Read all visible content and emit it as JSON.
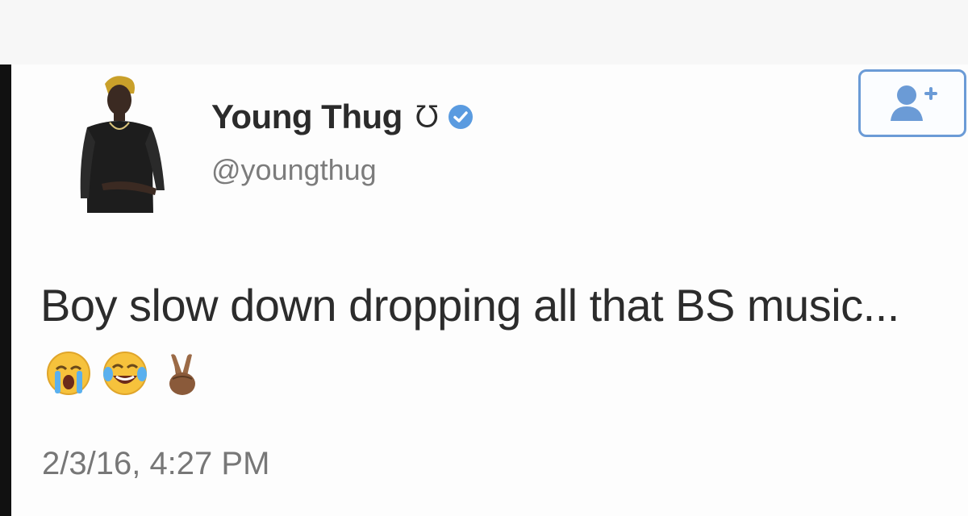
{
  "tweet": {
    "display_name": "Young Thug",
    "name_symbol": "ᘮ",
    "handle": "@youngthug",
    "text": "Boy slow down dropping all that BS music...",
    "timestamp": "2/3/16, 4:27 PM",
    "emojis": [
      "loudly-crying-face-icon",
      "face-with-tears-of-joy-icon",
      "victory-hand-icon"
    ]
  },
  "colors": {
    "accent": "#6b9bd6",
    "verified": "#5a9be0",
    "text": "#2c2c2c",
    "muted": "#7c7c7c"
  }
}
